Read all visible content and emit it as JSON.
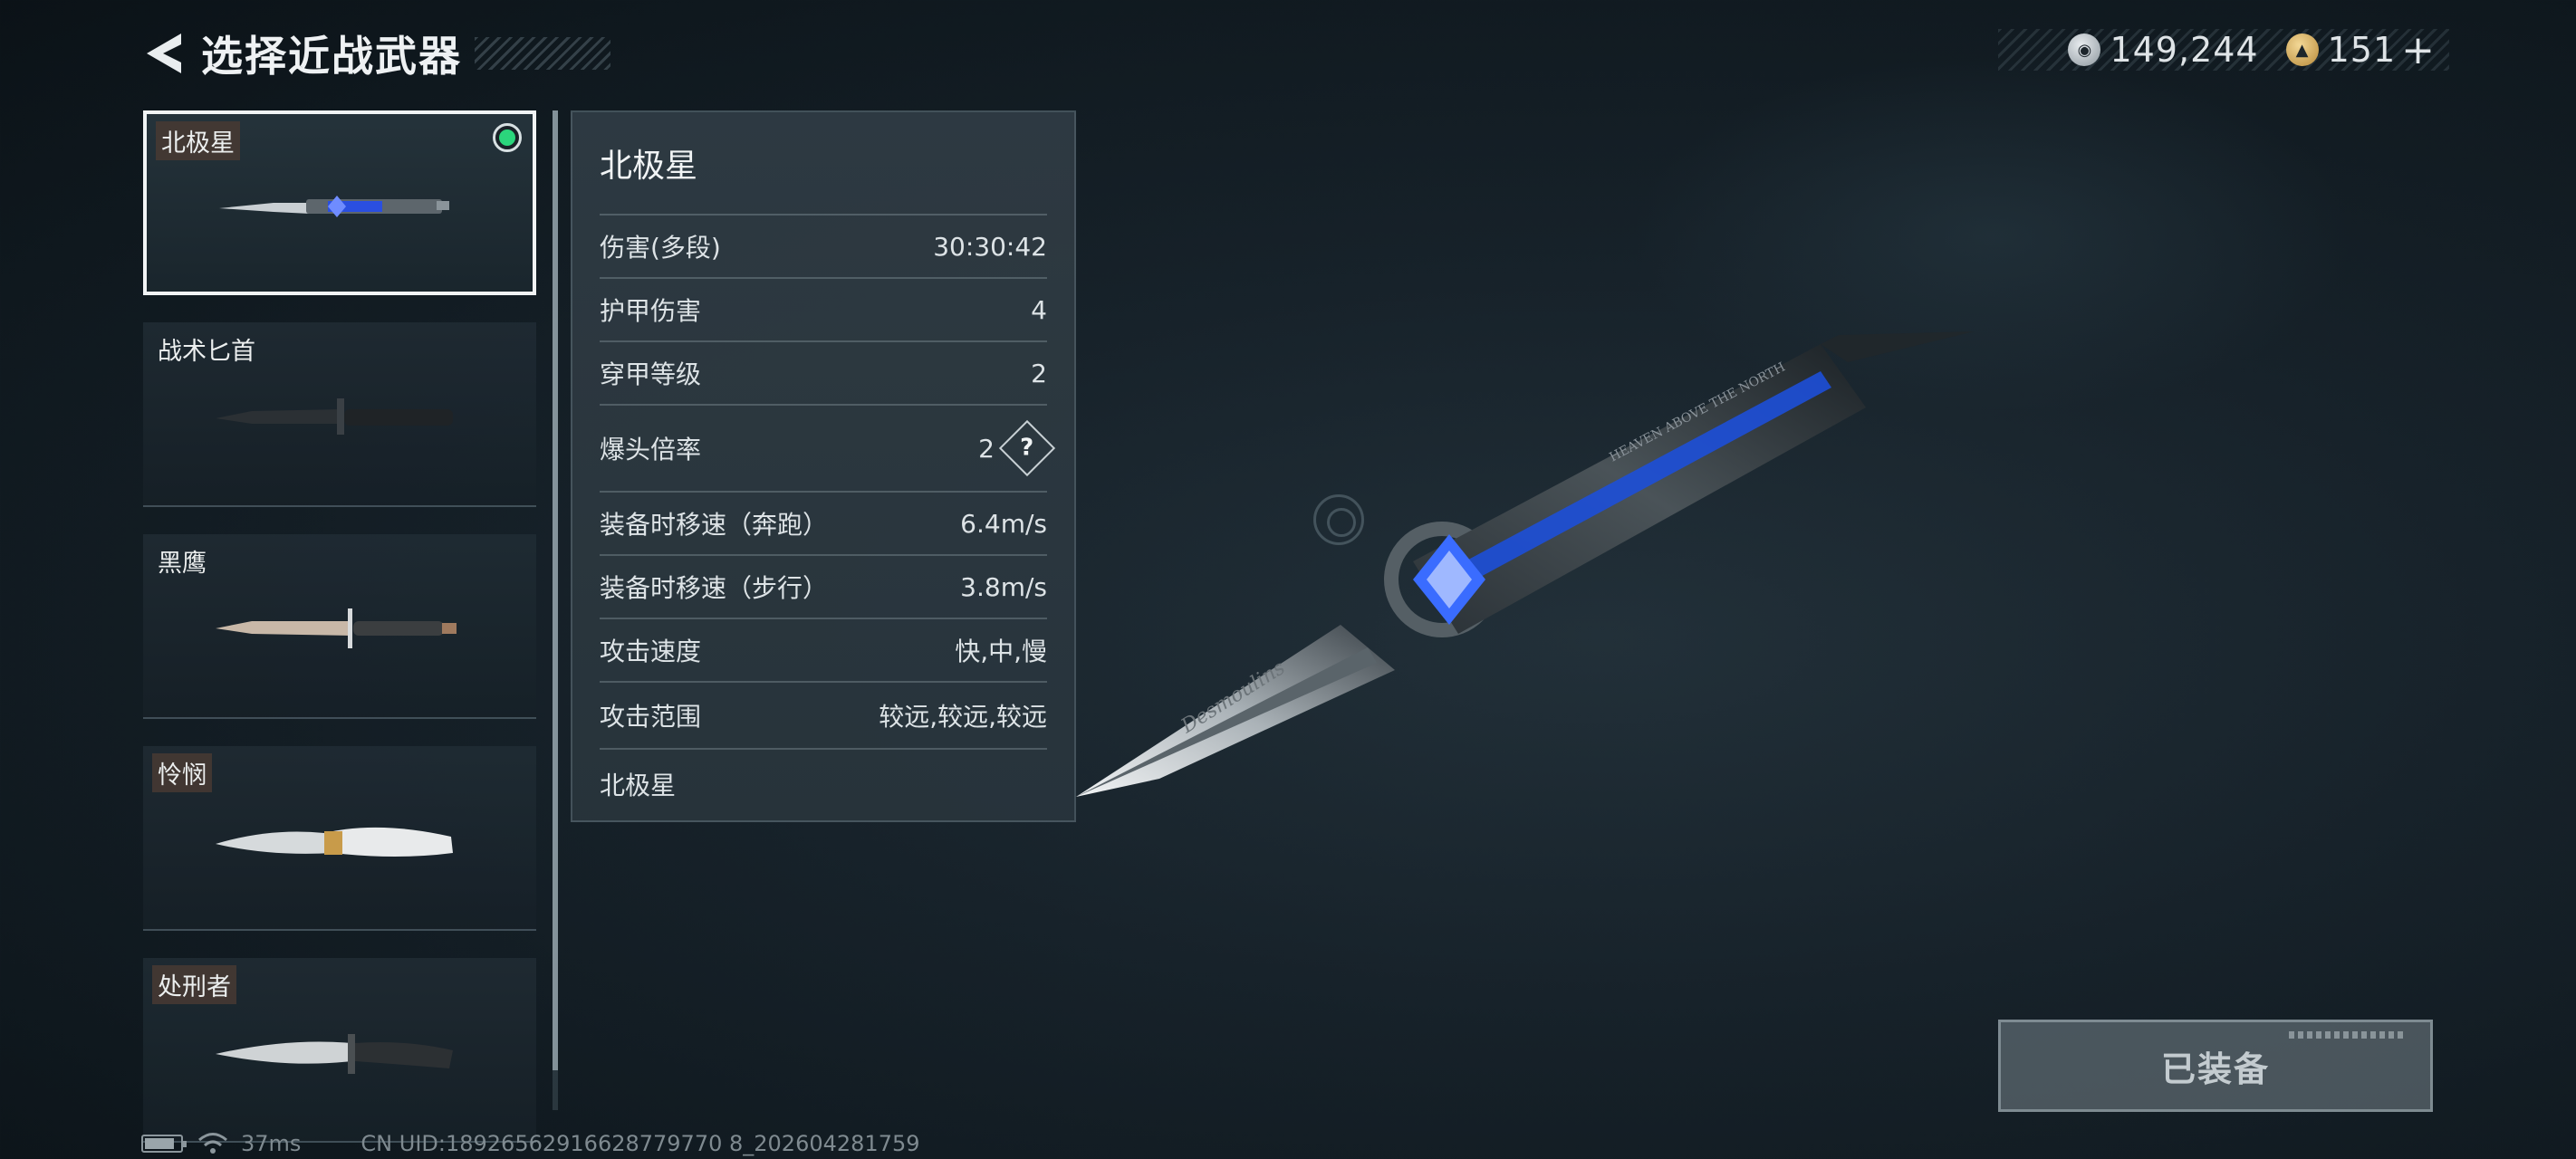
{
  "header": {
    "title": "选择近战武器"
  },
  "currency": {
    "silver": "149,244",
    "gold": "151",
    "plus": "+"
  },
  "weapons": [
    {
      "name": "北极星",
      "tagged": true,
      "selected": true,
      "equipped": true
    },
    {
      "name": "战术匕首",
      "tagged": false,
      "selected": false,
      "equipped": false
    },
    {
      "name": "黑鹰",
      "tagged": false,
      "selected": false,
      "equipped": false
    },
    {
      "name": "怜悯",
      "tagged": true,
      "selected": false,
      "equipped": false
    },
    {
      "name": "处刑者",
      "tagged": true,
      "selected": false,
      "equipped": false
    }
  ],
  "stats": {
    "title": "北极星",
    "rows": [
      {
        "label": "伤害(多段)",
        "value": "30:30:42"
      },
      {
        "label": "护甲伤害",
        "value": "4"
      },
      {
        "label": "穿甲等级",
        "value": "2"
      },
      {
        "label": "爆头倍率",
        "value": "2",
        "help": "?"
      },
      {
        "label": "装备时移速（奔跑）",
        "value": "6.4m/s"
      },
      {
        "label": "装备时移速（步行）",
        "value": "3.8m/s"
      },
      {
        "label": "攻击速度",
        "value": "快,中,慢"
      },
      {
        "label": "攻击范围",
        "value": "较远,较远,较远"
      }
    ],
    "footer": "北极星"
  },
  "preview": {
    "engraving": "Desmoulins",
    "blade_text": "HEAVEN ABOVE THE NORTH"
  },
  "equip_button": {
    "label": "已装备"
  },
  "status_bar": {
    "ping": "37ms",
    "uid": "CN UID:18926562916628779770 8_202604281759"
  },
  "colors": {
    "equipped_dot": "#2bd67c",
    "gem_blue": "#2a4fe0",
    "background": "#17222a"
  }
}
